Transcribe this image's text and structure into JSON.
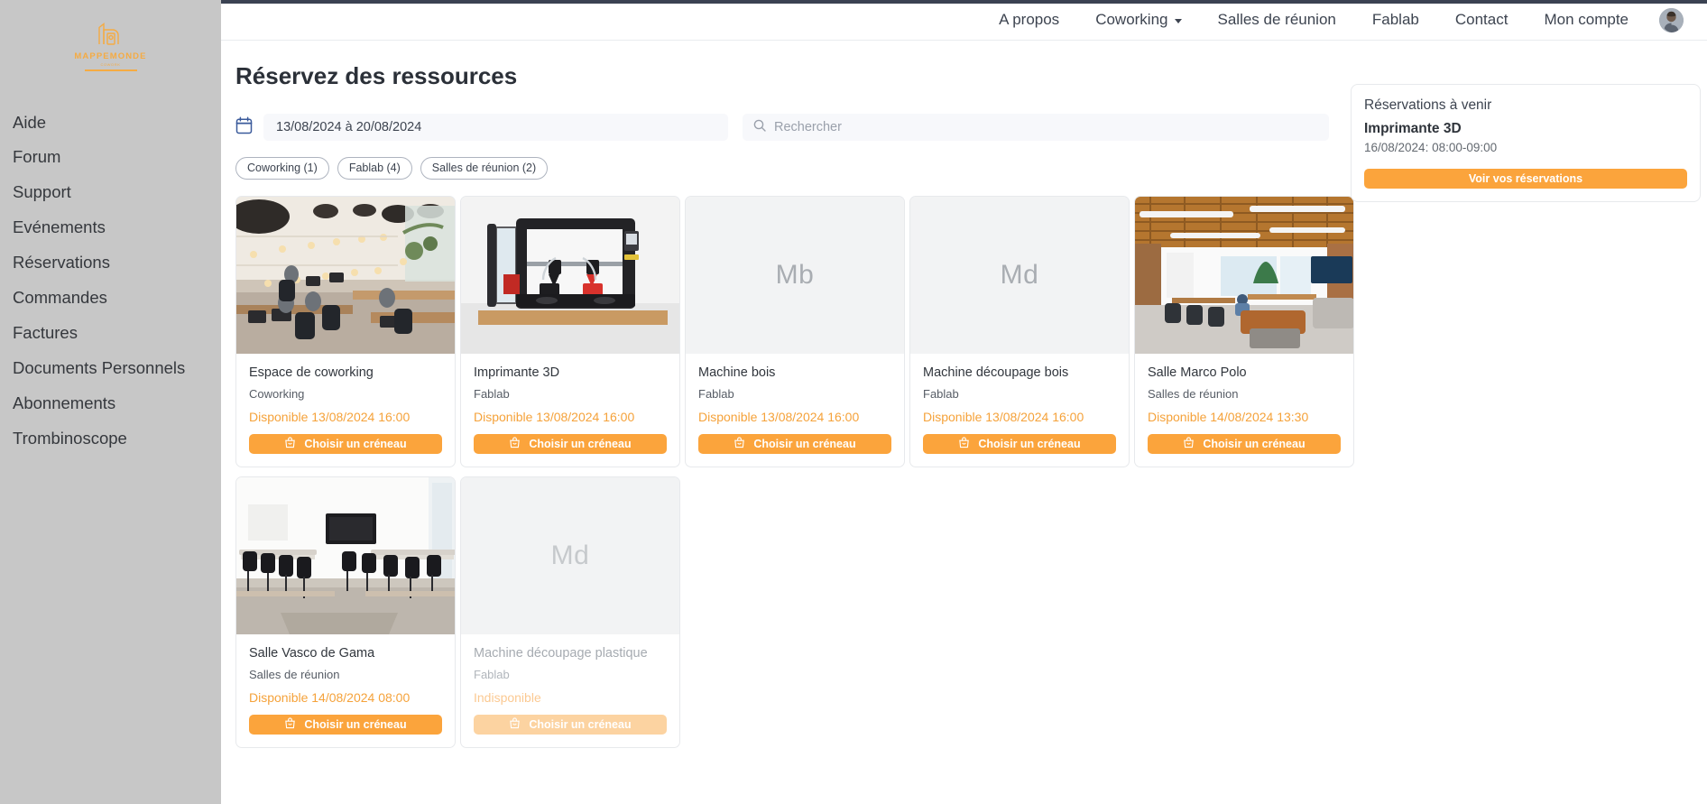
{
  "brand": {
    "logo_word": "MAPPEMONDE",
    "logo_sub": "COWORK",
    "logo_icon": "building-icon"
  },
  "sidebar": {
    "items": [
      {
        "label": "Aide"
      },
      {
        "label": "Forum"
      },
      {
        "label": "Support"
      },
      {
        "label": "Evénements"
      },
      {
        "label": "Réservations"
      },
      {
        "label": "Commandes"
      },
      {
        "label": "Factures"
      },
      {
        "label": "Documents Personnels"
      },
      {
        "label": "Abonnements"
      },
      {
        "label": "Trombinoscope"
      }
    ]
  },
  "topnav": {
    "links": [
      {
        "label": "A propos",
        "has_caret": false
      },
      {
        "label": "Coworking",
        "has_caret": true
      },
      {
        "label": "Salles de réunion",
        "has_caret": false
      },
      {
        "label": "Fablab",
        "has_caret": false
      },
      {
        "label": "Contact",
        "has_caret": false
      },
      {
        "label": "Mon compte",
        "has_caret": false
      }
    ],
    "avatar": "user-avatar"
  },
  "page": {
    "title": "Réservez des ressources"
  },
  "filters": {
    "calendar_icon": "calendar-icon",
    "date_range_value": "13/08/2024 à 20/08/2024",
    "search_icon": "search-icon",
    "search_value": "",
    "search_placeholder": "Rechercher",
    "chips": [
      {
        "label": "Coworking (1)"
      },
      {
        "label": "Fablab (4)"
      },
      {
        "label": "Salles de réunion (2)"
      }
    ]
  },
  "cards": [
    {
      "name": "Espace de coworking",
      "category": "Coworking",
      "availability": "Disponible 13/08/2024 16:00",
      "cta": "Choisir un créneau",
      "media": "photo-coworking-loft",
      "initials": "",
      "available": true
    },
    {
      "name": "Imprimante 3D",
      "category": "Fablab",
      "availability": "Disponible 13/08/2024 16:00",
      "cta": "Choisir un créneau",
      "media": "photo-3d-printer",
      "initials": "",
      "available": true
    },
    {
      "name": "Machine bois",
      "category": "Fablab",
      "availability": "Disponible 13/08/2024 16:00",
      "cta": "Choisir un créneau",
      "media": "placeholder",
      "initials": "Mb",
      "available": true
    },
    {
      "name": "Machine découpage bois",
      "category": "Fablab",
      "availability": "Disponible 13/08/2024 16:00",
      "cta": "Choisir un créneau",
      "media": "placeholder",
      "initials": "Md",
      "available": true
    },
    {
      "name": "Salle Marco Polo",
      "category": "Salles de réunion",
      "availability": "Disponible 14/08/2024 13:30",
      "cta": "Choisir un créneau",
      "media": "photo-open-office",
      "initials": "",
      "available": true
    },
    {
      "name": "Salle Vasco de Gama",
      "category": "Salles de réunion",
      "availability": "Disponible 14/08/2024 08:00",
      "cta": "Choisir un créneau",
      "media": "photo-meeting-room",
      "initials": "",
      "available": true
    },
    {
      "name": "Machine découpage plastique",
      "category": "Fablab",
      "availability": "Indisponible",
      "cta": "Choisir un créneau",
      "media": "placeholder",
      "initials": "Md",
      "available": false
    }
  ],
  "upcoming": {
    "title": "Réservations à venir",
    "resource": "Imprimante 3D",
    "slot": "16/08/2024: 08:00-09:00",
    "button": "Voir vos réservations"
  },
  "colors": {
    "accent": "#fba43c",
    "accent_text": "#f5a23a",
    "accent_muted": "#fcd3a1",
    "sidebar_bg": "#c7c7c7",
    "topstrip": "#3b4252",
    "field_bg": "#f7f8fb",
    "card_border": "#e7e9ec",
    "text": "#3d4450"
  }
}
